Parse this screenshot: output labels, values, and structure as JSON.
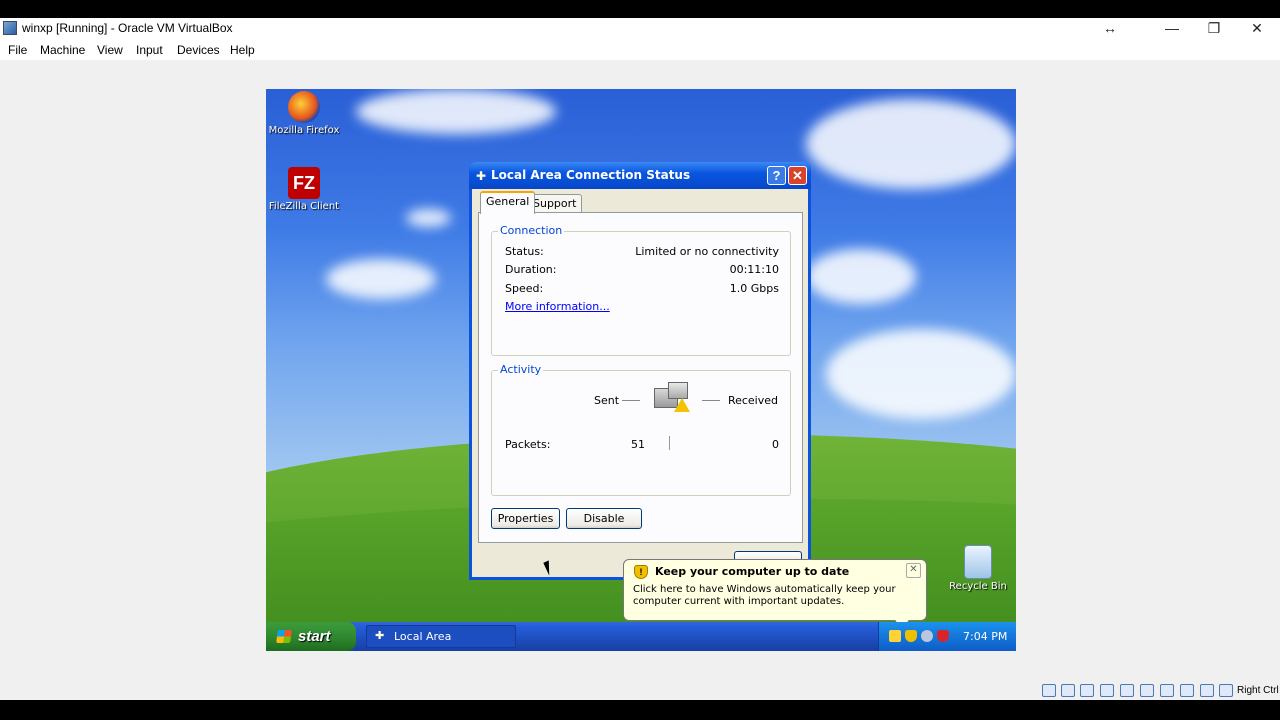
{
  "host": {
    "title": "winxp [Running] - Oracle VM VirtualBox",
    "menu": [
      "File",
      "Machine",
      "View",
      "Input",
      "Devices",
      "Help"
    ],
    "controls": {
      "resize_glyph": "↔",
      "minimize_glyph": "—",
      "restore_glyph": "❐",
      "close_glyph": "✕"
    },
    "host_key_label": "Right Ctrl"
  },
  "desktop": {
    "icons": [
      {
        "label": "Mozilla Firefox",
        "icon": "firefox-icon"
      },
      {
        "label": "FileZilla Client",
        "icon": "filezilla-icon"
      },
      {
        "label": "Recycle Bin",
        "icon": "recycle-bin-icon"
      }
    ]
  },
  "dialog": {
    "title": "Local Area Connection Status",
    "help_glyph": "?",
    "close_glyph": "✕",
    "tabs": [
      "General",
      "Support"
    ],
    "connection": {
      "group_title": "Connection",
      "rows": [
        {
          "label": "Status:",
          "value": "Limited or no connectivity"
        },
        {
          "label": "Duration:",
          "value": "00:11:10"
        },
        {
          "label": "Speed:",
          "value": "1.0 Gbps"
        }
      ],
      "more_info": "More information..."
    },
    "activity": {
      "group_title": "Activity",
      "sent_label": "Sent",
      "received_label": "Received",
      "packets_label": "Packets:",
      "packets_sent": "51",
      "packets_received": "0"
    },
    "buttons": {
      "properties": "Properties",
      "disable": "Disable"
    }
  },
  "balloon": {
    "title": "Keep your computer up to date",
    "text": "Click here to have Windows automatically keep your computer current with important updates.",
    "close_glyph": "✕"
  },
  "taskbar": {
    "start_label": "start",
    "task_item": "Local Area Connectio...",
    "clock": "7:04 PM"
  },
  "colors": {
    "xp_blue": "#0a53dd",
    "start_green": "#2f8a2f",
    "balloon_bg": "#ffffe1",
    "link": "#0000ff"
  }
}
